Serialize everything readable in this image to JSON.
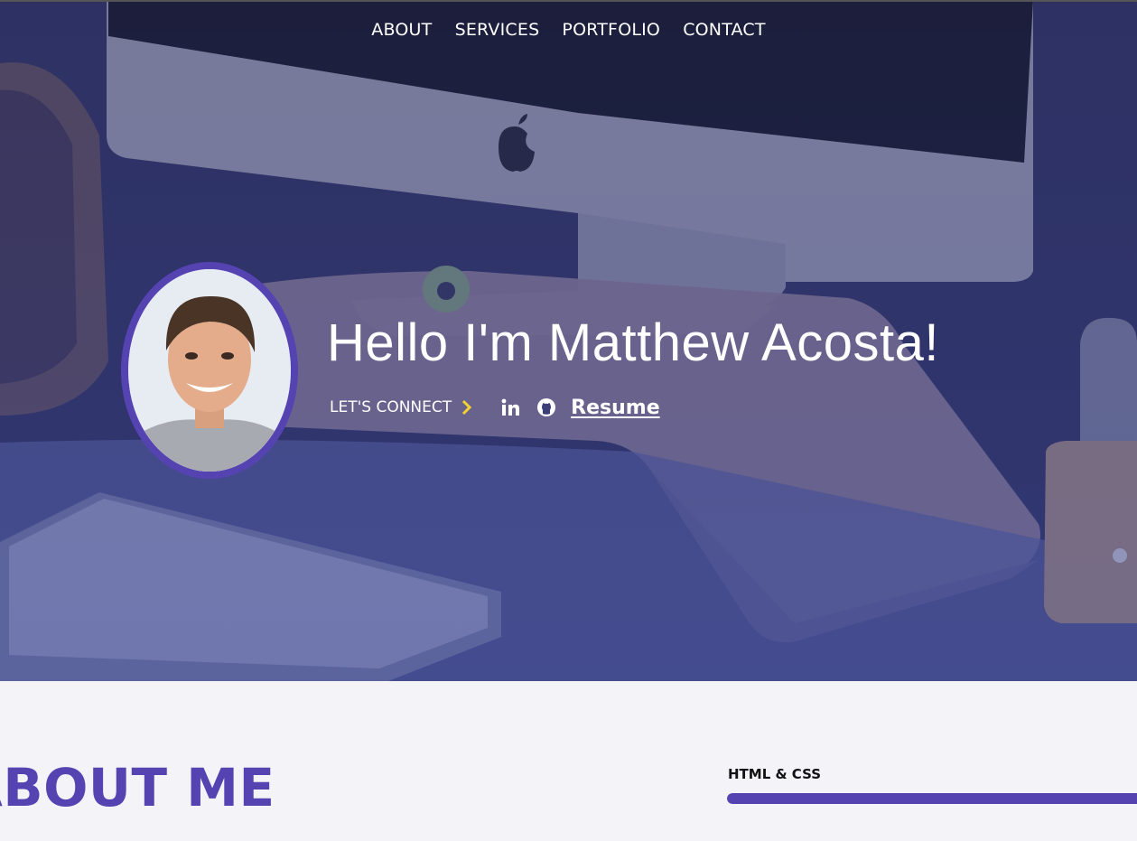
{
  "nav": {
    "items": [
      {
        "label": "ABOUT"
      },
      {
        "label": "SERVICES"
      },
      {
        "label": "PORTFOLIO"
      },
      {
        "label": "CONTACT"
      }
    ]
  },
  "hero": {
    "title": "Hello I'm Matthew Acosta!",
    "connect_label": "LET'S CONNECT",
    "connect_icon": "chevron-right-icon",
    "social": [
      {
        "icon": "linkedin-icon"
      },
      {
        "icon": "github-icon"
      }
    ],
    "resume_label": "Resume",
    "accent_color": "#5643b2",
    "chevron_color": "#f5d233"
  },
  "about": {
    "title": "ABOUT ME",
    "skills": [
      {
        "label": "HTML & CSS",
        "level": 1.0
      }
    ]
  }
}
